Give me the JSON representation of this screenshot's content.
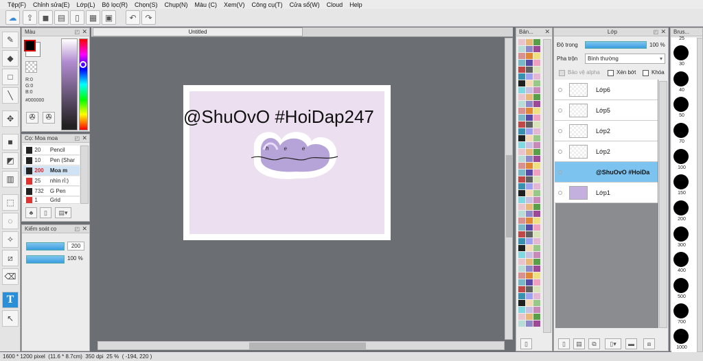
{
  "menu": [
    "Tệp(F)",
    "Chỉnh sửa(E)",
    "Lớp(L)",
    "Bộ lọc(R)",
    "Chọn(S)",
    "Chụp(N)",
    "Màu (C)",
    "Xem(V)",
    "Công cụ(T)",
    "Cửa sổ(W)",
    "Cloud",
    "Help"
  ],
  "color_panel": {
    "title": "Màu",
    "r": "R:0",
    "g": "G:0",
    "b": "B:0",
    "hex": "#000000"
  },
  "brush_panel": {
    "title": "Cọ: Moa moa",
    "items": [
      {
        "size": "20",
        "label": "Pencil",
        "color": "#222222"
      },
      {
        "size": "10",
        "label": "Pen (Shar",
        "color": "#222222"
      },
      {
        "size": "200",
        "label": "Moa m",
        "color": "#222222"
      },
      {
        "size": "25",
        "label": "nhìn rỉ:)",
        "color": "#cc3333"
      },
      {
        "size": "732",
        "label": "G Pen",
        "color": "#222222"
      },
      {
        "size": "1",
        "label": "Grid",
        "color": "#cc3333"
      }
    ]
  },
  "brush_control": {
    "title": "Kiểm soát cọ",
    "size": "200",
    "opacity": "100 %"
  },
  "canvas": {
    "tab": "Untitled",
    "overlay_text": "@ShuOvO #HoiDap247",
    "sticker_word": "hee"
  },
  "swatch_panel": {
    "title": "Bản..."
  },
  "layer_panel": {
    "title": "Lớp",
    "opacity_label": "Độ trong",
    "opacity_value": "100 %",
    "blend_label": "Pha trộn",
    "blend_value": "Bình thường",
    "protect_alpha": "Bảo vệ alpha",
    "clip": "Xén bớt",
    "lock": "Khóa",
    "layers": [
      "Lớp6",
      "Lớp5",
      "Lớp2",
      "Lớp2",
      "@ShuOvO #HoiDa",
      "Lớp1"
    ]
  },
  "brush_size_panel": {
    "title": "Brus...",
    "sizes": [
      "25",
      "30",
      "40",
      "50",
      "70",
      "100",
      "150",
      "200",
      "300",
      "400",
      "500",
      "700",
      "1000"
    ]
  },
  "status": "1600 * 1200 pixel  (11.6 * 8.7cm)  350 dpi  25 %  ( -194, 220 )"
}
